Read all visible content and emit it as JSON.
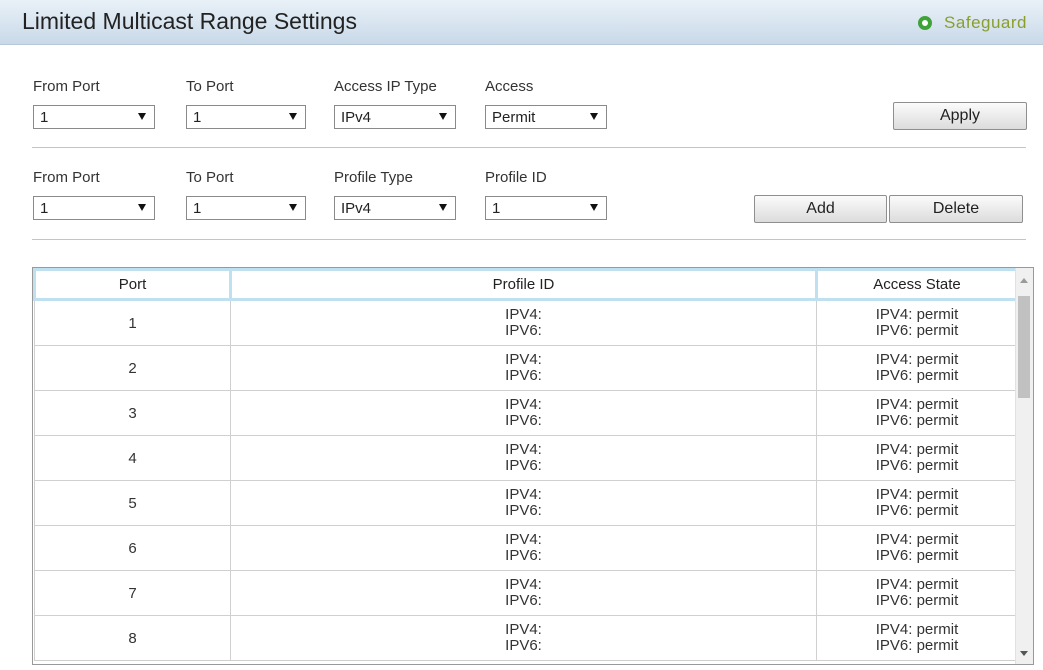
{
  "title": "Limited Multicast Range Settings",
  "safeguard": "Safeguard",
  "form1": {
    "from_port_label": "From Port",
    "to_port_label": "To Port",
    "access_ip_type_label": "Access IP Type",
    "access_label": "Access",
    "from_port_value": "1",
    "to_port_value": "1",
    "access_ip_type_value": "IPv4",
    "access_value": "Permit",
    "apply_label": "Apply"
  },
  "form2": {
    "from_port_label": "From Port",
    "to_port_label": "To Port",
    "profile_type_label": "Profile Type",
    "profile_id_label": "Profile ID",
    "from_port_value": "1",
    "to_port_value": "1",
    "profile_type_value": "IPv4",
    "profile_id_value": "1",
    "add_label": "Add",
    "delete_label": "Delete"
  },
  "table": {
    "headers": [
      "Port",
      "Profile ID",
      "Access State"
    ],
    "rows": [
      {
        "port": "1",
        "profile": [
          "IPV4:",
          "IPV6:"
        ],
        "access": [
          "IPV4:  permit",
          "IPV6:  permit"
        ]
      },
      {
        "port": "2",
        "profile": [
          "IPV4:",
          "IPV6:"
        ],
        "access": [
          "IPV4:  permit",
          "IPV6:  permit"
        ]
      },
      {
        "port": "3",
        "profile": [
          "IPV4:",
          "IPV6:"
        ],
        "access": [
          "IPV4:  permit",
          "IPV6:  permit"
        ]
      },
      {
        "port": "4",
        "profile": [
          "IPV4:",
          "IPV6:"
        ],
        "access": [
          "IPV4:  permit",
          "IPV6:  permit"
        ]
      },
      {
        "port": "5",
        "profile": [
          "IPV4:",
          "IPV6:"
        ],
        "access": [
          "IPV4:  permit",
          "IPV6:  permit"
        ]
      },
      {
        "port": "6",
        "profile": [
          "IPV4:",
          "IPV6:"
        ],
        "access": [
          "IPV4:  permit",
          "IPV6:  permit"
        ]
      },
      {
        "port": "7",
        "profile": [
          "IPV4:",
          "IPV6:"
        ],
        "access": [
          "IPV4:  permit",
          "IPV6:  permit"
        ]
      },
      {
        "port": "8",
        "profile": [
          "IPV4:",
          "IPV6:"
        ],
        "access": [
          "IPV4:  permit",
          "IPV6:  permit"
        ]
      }
    ]
  }
}
